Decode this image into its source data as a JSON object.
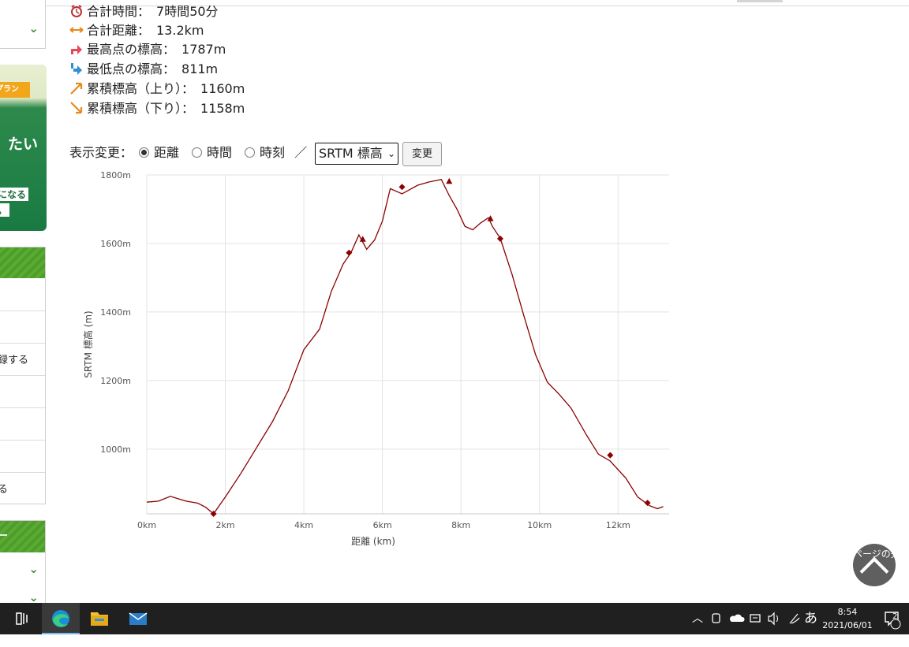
{
  "stats": [
    {
      "icon": "alarm-clock-icon",
      "label": "合計時間：",
      "value": "7時間50分"
    },
    {
      "icon": "distance-arrow-icon",
      "label": "合計距離：",
      "value": "13.2km"
    },
    {
      "icon": "highest-point-icon",
      "label": "最高点の標高：",
      "value": "1787m"
    },
    {
      "icon": "lowest-point-icon",
      "label": "最低点の標高：",
      "value": "811m"
    },
    {
      "icon": "ascent-arrow-icon",
      "label": "累積標高（上り）：",
      "value": "1160m"
    },
    {
      "icon": "descent-arrow-icon",
      "label": "累積標高（下り）：",
      "value": "1158m"
    }
  ],
  "controls": {
    "label": "表示変更：",
    "radios": [
      "距離",
      "時間",
      "時刻"
    ],
    "selected": "距離",
    "separator": "／",
    "select_value": "SRTM 標高",
    "button": "変更"
  },
  "sidebar": {
    "ad_tag": "プラン",
    "ad_text": "たい",
    "ad_sub1": "になる",
    "ad_sub2": "。",
    "menu_item_1": "録する",
    "menu_item_2": "る",
    "menu2_head": "ー"
  },
  "chart_data": {
    "type": "line",
    "xlabel": "距離 (km)",
    "ylabel": "SRTM 標高 (m)",
    "xlim": [
      0,
      13.3
    ],
    "ylim": [
      811,
      1800
    ],
    "x_ticks": [
      "0km",
      "2km",
      "4km",
      "6km",
      "8km",
      "10km",
      "12km"
    ],
    "y_ticks": [
      "1000m",
      "1200m",
      "1400m",
      "1600m",
      "1800m"
    ],
    "grid": true,
    "color": "#8b0000",
    "series": [
      {
        "x": [
          0,
          0.3,
          0.6,
          0.8,
          1.0,
          1.3,
          1.5,
          1.7,
          2.0,
          2.4,
          2.8,
          3.2,
          3.6,
          4.0,
          4.4,
          4.7,
          5.0,
          5.2,
          5.4,
          5.6,
          5.8,
          6.0,
          6.2,
          6.5,
          6.9,
          7.2,
          7.5,
          7.7,
          7.9,
          8.1,
          8.3,
          8.5,
          8.7,
          8.8,
          9.0,
          9.3,
          9.6,
          9.9,
          10.2,
          10.5,
          10.8,
          11.2,
          11.5,
          11.8,
          12.2,
          12.5,
          12.8,
          13.0,
          13.15
        ],
        "y": [
          845,
          848,
          862,
          855,
          848,
          842,
          830,
          811,
          860,
          930,
          1005,
          1080,
          1170,
          1290,
          1350,
          1460,
          1540,
          1573,
          1625,
          1583,
          1610,
          1665,
          1760,
          1745,
          1770,
          1780,
          1787,
          1740,
          1700,
          1650,
          1640,
          1660,
          1675,
          1650,
          1615,
          1510,
          1390,
          1275,
          1195,
          1160,
          1120,
          1040,
          985,
          965,
          915,
          860,
          835,
          826,
          832
        ]
      }
    ],
    "markers": [
      {
        "x": 1.7,
        "y": 811,
        "shape": "diamond"
      },
      {
        "x": 5.15,
        "y": 1573,
        "shape": "diamond"
      },
      {
        "x": 5.5,
        "y": 1612,
        "shape": "triangle"
      },
      {
        "x": 6.5,
        "y": 1765,
        "shape": "diamond"
      },
      {
        "x": 7.7,
        "y": 1781,
        "shape": "triangle"
      },
      {
        "x": 8.75,
        "y": 1672,
        "shape": "triangle"
      },
      {
        "x": 9.0,
        "y": 1614,
        "shape": "diamond"
      },
      {
        "x": 11.8,
        "y": 982,
        "shape": "diamond"
      },
      {
        "x": 12.75,
        "y": 843,
        "shape": "diamond"
      }
    ]
  },
  "back_to_top": "ページの先頭へ",
  "taskbar": {
    "time": "8:54",
    "date": "2021/06/01",
    "ime": "あ",
    "notification_count": "2"
  }
}
